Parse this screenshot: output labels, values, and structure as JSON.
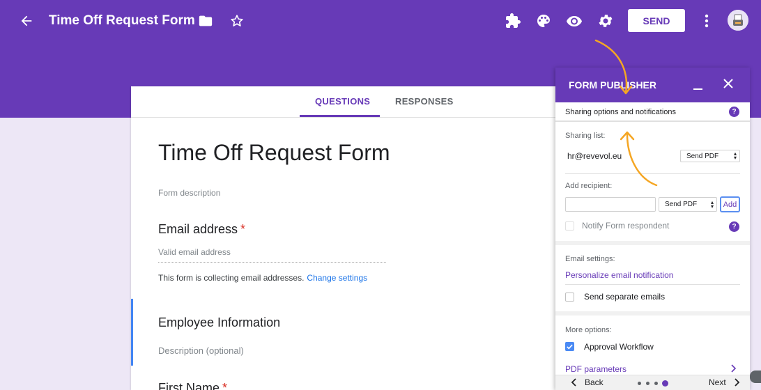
{
  "header": {
    "title": "Time Off Request Form",
    "send_label": "SEND",
    "icons": [
      "back-arrow-icon",
      "folder-icon",
      "star-icon",
      "puzzle-icon",
      "palette-icon",
      "eye-icon",
      "gear-icon",
      "more-vert-icon"
    ]
  },
  "form": {
    "tabs": [
      {
        "label": "QUESTIONS",
        "active": true
      },
      {
        "label": "RESPONSES",
        "active": false
      }
    ],
    "title": "Time Off Request Form",
    "description_placeholder": "Form description",
    "email_question": {
      "title": "Email address",
      "required_mark": "*",
      "placeholder": "Valid email address"
    },
    "collecting_note": "This form is collecting email addresses.",
    "change_settings": "Change settings",
    "section_title": "Employee Information",
    "section_desc_placeholder": "Description (optional)",
    "next_question": {
      "title": "First Name",
      "required_mark": "*"
    }
  },
  "panel": {
    "title": "FORM PUBLISHER",
    "subheader": "Sharing options and notifications",
    "help": "?",
    "sharing_list_label": "Sharing list:",
    "sharing_email": "hr@revevol.eu",
    "sharing_mode": "Send PDF",
    "add_recipient_label": "Add recipient:",
    "recipient_input_value": "",
    "recipient_mode": "Send PDF",
    "add_button": "Add",
    "notify_label": "Notify Form respondent",
    "email_settings_label": "Email settings:",
    "personalize_link": "Personalize email notification",
    "separate_emails_label": "Send separate emails",
    "separate_emails_checked": false,
    "more_options_label": "More options:",
    "approval_label": "Approval Workflow",
    "approval_checked": true,
    "pdf_parameters_link": "PDF parameters",
    "footer": {
      "back": "Back",
      "next": "Next",
      "page_count": 4,
      "active_page": 4
    }
  },
  "colors": {
    "brand": "#673ab7",
    "annotation": "#f5a623",
    "checkbox_on": "#4a8af4",
    "link": "#1a73e8"
  }
}
